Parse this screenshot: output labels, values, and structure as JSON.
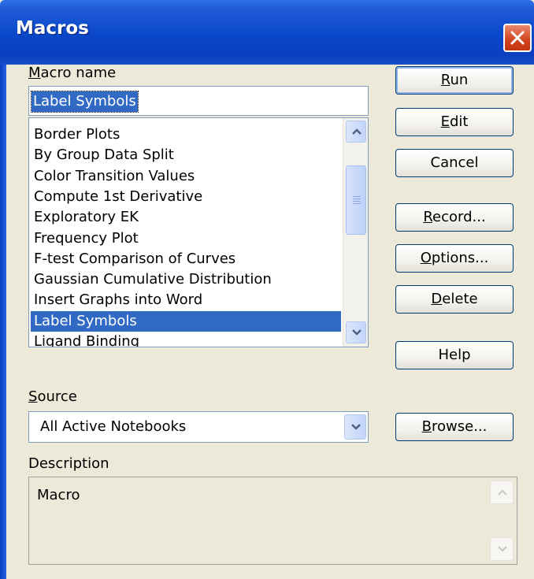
{
  "window": {
    "title": "Macros"
  },
  "macro_name": {
    "label_prefix": "",
    "label_mnemonic": "M",
    "label_rest": "acro name",
    "value": "Label Symbols"
  },
  "macro_list": {
    "items": [
      "Border Plots",
      "By Group Data Split",
      "Color Transition Values",
      "Compute 1st Derivative",
      "Exploratory EK",
      "Frequency Plot",
      "F-test Comparison of Curves",
      "Gaussian Cumulative Distribution",
      "Insert Graphs into Word",
      "Label Symbols",
      "Ligand Binding"
    ],
    "selected": "Label Symbols"
  },
  "buttons": {
    "run": {
      "pre": "",
      "mn": "R",
      "post": "un"
    },
    "edit": {
      "pre": "",
      "mn": "E",
      "post": "dit"
    },
    "cancel": {
      "pre": "Cancel",
      "mn": "",
      "post": ""
    },
    "record": {
      "pre": "",
      "mn": "R",
      "post": "ecord..."
    },
    "options": {
      "pre": "",
      "mn": "O",
      "post": "ptions..."
    },
    "delete": {
      "pre": "",
      "mn": "D",
      "post": "elete"
    },
    "help": {
      "pre": "Help",
      "mn": "",
      "post": ""
    },
    "browse": {
      "pre": "",
      "mn": "B",
      "post": "rowse..."
    }
  },
  "source": {
    "label_mnemonic": "S",
    "label_rest": "ource",
    "value": "All Active Notebooks"
  },
  "description": {
    "label": "Description",
    "text": "Macro"
  },
  "colors": {
    "titlebar": "#0a47c9",
    "selection": "#316ac5",
    "dialog_bg": "#ece9d8",
    "close_button": "#d2431e"
  },
  "icons": {
    "close": "close-x-icon",
    "scroll_up": "chevron-up-icon",
    "scroll_down": "chevron-down-icon",
    "combo": "chevron-down-icon"
  }
}
